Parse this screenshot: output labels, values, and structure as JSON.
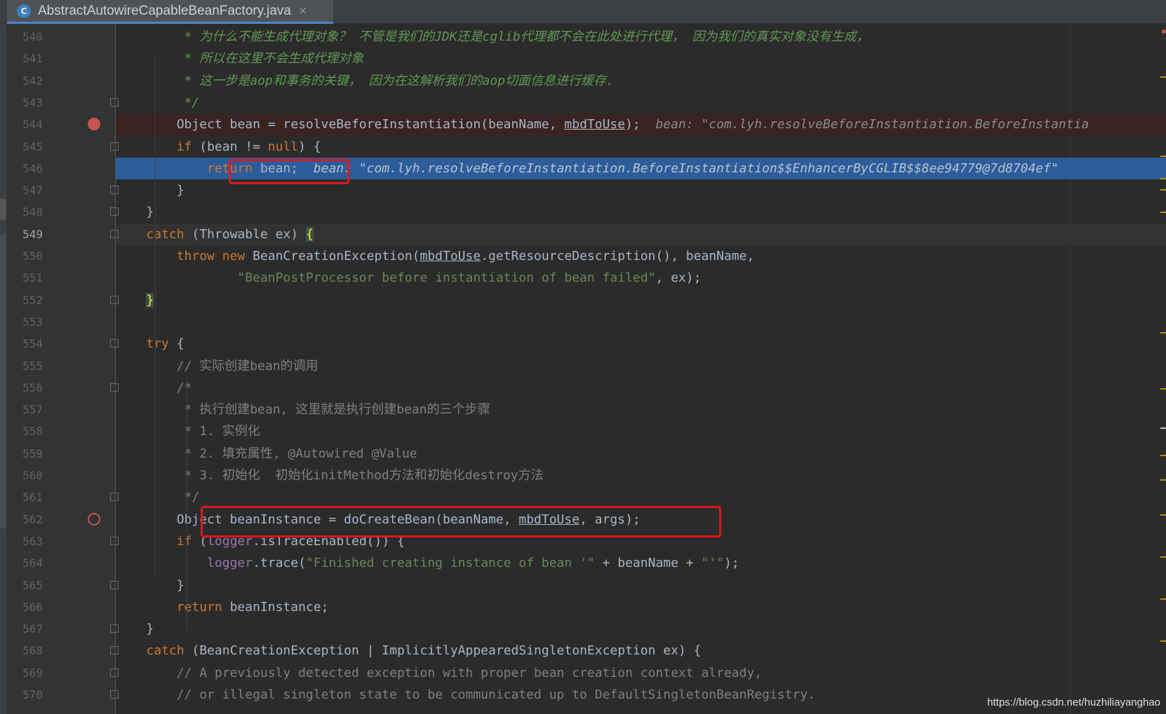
{
  "editor": {
    "tab": {
      "title": "AbstractAutowireCapableBeanFactory.java",
      "icon": "class-c-icon",
      "icon_glyph": "C",
      "close_glyph": "✕"
    },
    "accent_color": "#4a88c7",
    "breakpoint_color": "#c75450"
  },
  "lines": [
    {
      "num": "540",
      "tokens": [
        {
          "t": "         * 为什么不能生成代理对象？ 不管是我们的JDK还是cglib代理都不会在此处进行代理， 因为我们的真实对象没有生成，",
          "c": "cmt"
        }
      ]
    },
    {
      "num": "541",
      "tokens": [
        {
          "t": "         * 所以在这里不会生成代理对象",
          "c": "cmt"
        }
      ]
    },
    {
      "num": "542",
      "tokens": [
        {
          "t": "         * 这一步是aop和事务的关键， 因为在这解析我们的aop切面信息进行缓存.",
          "c": "cmt"
        }
      ]
    },
    {
      "num": "543",
      "tokens": [
        {
          "t": "         */",
          "c": "cmt"
        }
      ]
    },
    {
      "num": "544",
      "tokens": [
        {
          "t": "        Object bean = resolveBeforeInstantiation(beanName, ",
          "c": ""
        },
        {
          "t": "mbdToUse",
          "c": "ul"
        },
        {
          "t": ");  ",
          "c": ""
        },
        {
          "t": "bean: \"com.lyh.resolveBeforeInstantiation.BeforeInstantia",
          "c": "hint"
        }
      ]
    },
    {
      "num": "545",
      "tokens": [
        {
          "t": "        ",
          "c": ""
        },
        {
          "t": "if",
          "c": "kw"
        },
        {
          "t": " (bean != ",
          "c": ""
        },
        {
          "t": "null",
          "c": "kw"
        },
        {
          "t": ") {",
          "c": ""
        }
      ]
    },
    {
      "num": "546",
      "tokens": [
        {
          "t": "            ",
          "c": ""
        },
        {
          "t": "return",
          "c": "ret-in-exec"
        },
        {
          "t": " bean;",
          "c": ""
        },
        {
          "t": "  bean: \"com.lyh.resolveBeforeInstantiation.BeforeInstantiation$$EnhancerByCGLIB$$8ee94779@7d8704ef\"",
          "c": "hint-light"
        }
      ]
    },
    {
      "num": "547",
      "tokens": [
        {
          "t": "        }",
          "c": ""
        }
      ]
    },
    {
      "num": "548",
      "tokens": [
        {
          "t": "    }",
          "c": ""
        }
      ]
    },
    {
      "num": "549",
      "tokens": [
        {
          "t": "    ",
          "c": ""
        },
        {
          "t": "catch",
          "c": "kw"
        },
        {
          "t": " (Throwable ex) ",
          "c": ""
        },
        {
          "t": "{",
          "c": "brace-y"
        }
      ]
    },
    {
      "num": "550",
      "tokens": [
        {
          "t": "        ",
          "c": ""
        },
        {
          "t": "throw new",
          "c": "kw"
        },
        {
          "t": " BeanCreationException(",
          "c": ""
        },
        {
          "t": "mbdToUse",
          "c": "ul"
        },
        {
          "t": ".getResourceDescription(), beanName,",
          "c": ""
        }
      ]
    },
    {
      "num": "551",
      "tokens": [
        {
          "t": "                ",
          "c": ""
        },
        {
          "t": "\"BeanPostProcessor before instantiation of bean failed\"",
          "c": "str"
        },
        {
          "t": ", ex);",
          "c": ""
        }
      ]
    },
    {
      "num": "552",
      "tokens": [
        {
          "t": "    ",
          "c": ""
        },
        {
          "t": "}",
          "c": "brace-y"
        }
      ]
    },
    {
      "num": "553",
      "tokens": []
    },
    {
      "num": "554",
      "tokens": [
        {
          "t": "    ",
          "c": ""
        },
        {
          "t": "try",
          "c": "kw"
        },
        {
          "t": " {",
          "c": ""
        }
      ]
    },
    {
      "num": "555",
      "tokens": [
        {
          "t": "        // 实际创建bean的调用",
          "c": "cmt2"
        }
      ]
    },
    {
      "num": "556",
      "tokens": [
        {
          "t": "        /*",
          "c": "cmt2"
        }
      ]
    },
    {
      "num": "557",
      "tokens": [
        {
          "t": "         * 执行创建bean, 这里就是执行创建bean的三个步骤",
          "c": "cmt2"
        }
      ]
    },
    {
      "num": "558",
      "tokens": [
        {
          "t": "         * 1. 实例化",
          "c": "cmt2"
        }
      ]
    },
    {
      "num": "559",
      "tokens": [
        {
          "t": "         * 2. 填充属性, @Autowired @Value",
          "c": "cmt2"
        }
      ]
    },
    {
      "num": "560",
      "tokens": [
        {
          "t": "         * 3. 初始化  初始化initMethod方法和初始化destroy方法",
          "c": "cmt2"
        }
      ]
    },
    {
      "num": "561",
      "tokens": [
        {
          "t": "         */",
          "c": "cmt2"
        }
      ]
    },
    {
      "num": "562",
      "tokens": [
        {
          "t": "        Object beanInstance = doCreateBean(beanName, ",
          "c": ""
        },
        {
          "t": "mbdToUse",
          "c": "ul"
        },
        {
          "t": ", args);",
          "c": ""
        }
      ]
    },
    {
      "num": "563",
      "tokens": [
        {
          "t": "        ",
          "c": ""
        },
        {
          "t": "if",
          "c": "kw"
        },
        {
          "t": " (",
          "c": ""
        },
        {
          "t": "logger",
          "c": "fld"
        },
        {
          "t": ".isTraceEnabled()) {",
          "c": ""
        }
      ]
    },
    {
      "num": "564",
      "tokens": [
        {
          "t": "            ",
          "c": ""
        },
        {
          "t": "logger",
          "c": "fld"
        },
        {
          "t": ".trace(",
          "c": ""
        },
        {
          "t": "\"Finished creating instance of bean '\"",
          "c": "str"
        },
        {
          "t": " + beanName + ",
          "c": ""
        },
        {
          "t": "\"'\"",
          "c": "str"
        },
        {
          "t": ");",
          "c": ""
        }
      ]
    },
    {
      "num": "565",
      "tokens": [
        {
          "t": "        }",
          "c": ""
        }
      ]
    },
    {
      "num": "566",
      "tokens": [
        {
          "t": "        ",
          "c": ""
        },
        {
          "t": "return",
          "c": "kw"
        },
        {
          "t": " beanInstance;",
          "c": ""
        }
      ]
    },
    {
      "num": "567",
      "tokens": [
        {
          "t": "    }",
          "c": ""
        }
      ]
    },
    {
      "num": "568",
      "tokens": [
        {
          "t": "    ",
          "c": ""
        },
        {
          "t": "catch",
          "c": "kw"
        },
        {
          "t": " (BeanCreationException | ImplicitlyAppearedSingletonException ex) {",
          "c": ""
        }
      ]
    },
    {
      "num": "569",
      "tokens": [
        {
          "t": "        // A previously detected exception with proper bean creation context already,",
          "c": "cmt2"
        }
      ]
    },
    {
      "num": "570",
      "tokens": [
        {
          "t": "        // or illegal singleton state to be communicated up to DefaultSingletonBeanRegistry.",
          "c": "cmt2"
        }
      ]
    }
  ],
  "watermark": "https://blog.csdn.net/huzhiliayanghao"
}
